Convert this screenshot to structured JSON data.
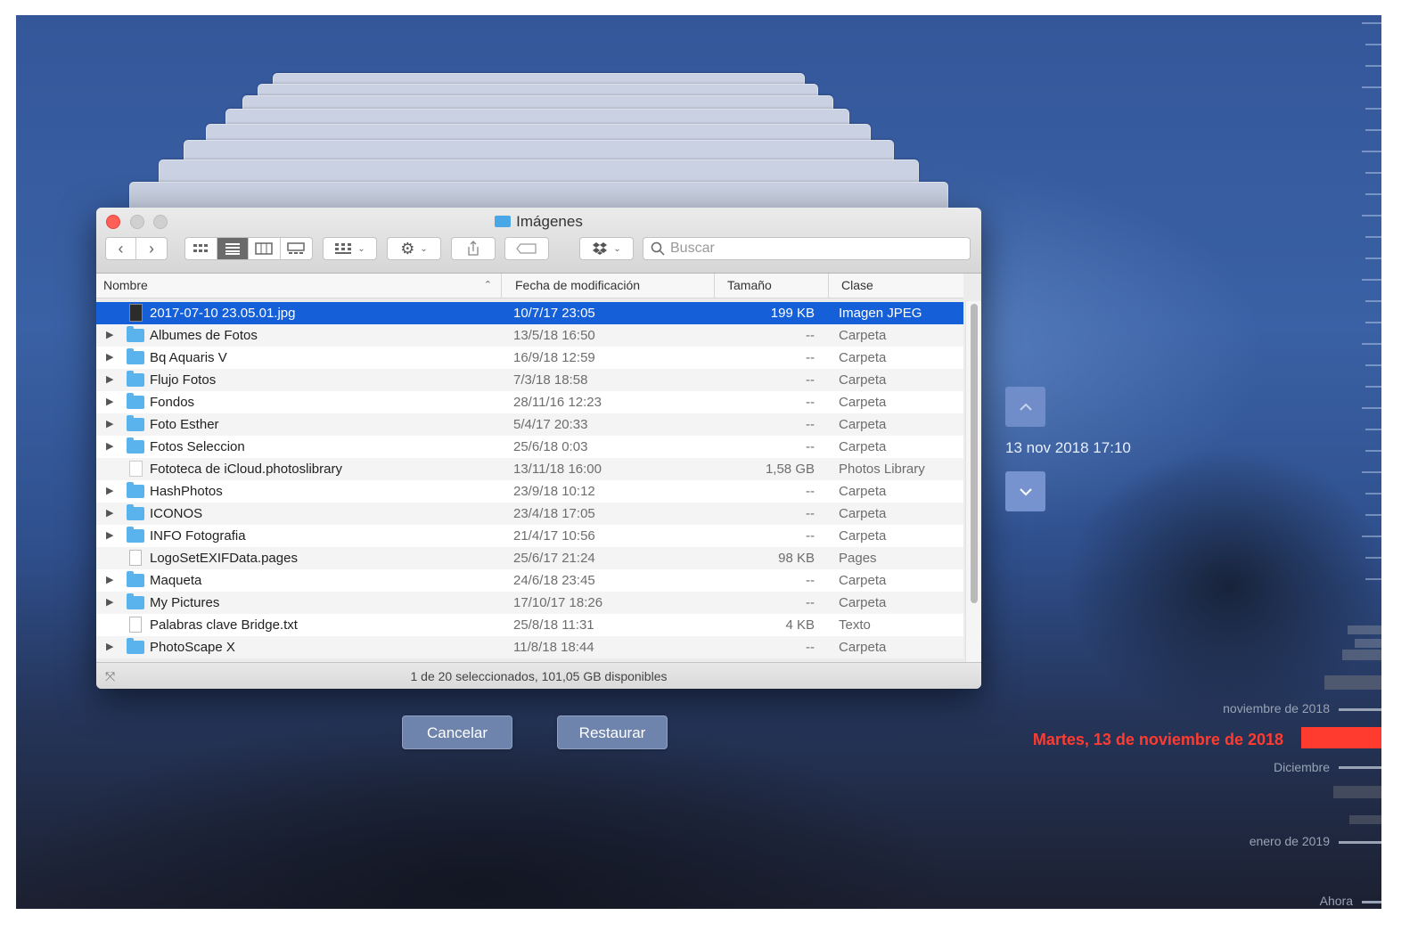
{
  "window": {
    "title": "Imágenes",
    "search_placeholder": "Buscar",
    "columns": {
      "name": "Nombre",
      "modified": "Fecha de modificación",
      "size": "Tamaño",
      "kind": "Clase"
    },
    "rows": [
      {
        "name": "2017-07-10 23.05.01.jpg",
        "modified": "10/7/17 23:05",
        "size": "199 KB",
        "kind": "Imagen JPEG",
        "icon": "jpeg-file-icon",
        "expandable": false,
        "selected": true
      },
      {
        "name": "Albumes de Fotos",
        "modified": "13/5/18 16:50",
        "size": "--",
        "kind": "Carpeta",
        "icon": "folder-icon",
        "expandable": true
      },
      {
        "name": "Bq Aquaris V",
        "modified": "16/9/18 12:59",
        "size": "--",
        "kind": "Carpeta",
        "icon": "folder-icon",
        "expandable": true
      },
      {
        "name": "Flujo Fotos",
        "modified": "7/3/18 18:58",
        "size": "--",
        "kind": "Carpeta",
        "icon": "folder-icon",
        "expandable": true
      },
      {
        "name": "Fondos",
        "modified": "28/11/16 12:23",
        "size": "--",
        "kind": "Carpeta",
        "icon": "folder-icon",
        "expandable": true
      },
      {
        "name": "Foto Esther",
        "modified": "5/4/17 20:33",
        "size": "--",
        "kind": "Carpeta",
        "icon": "folder-icon",
        "expandable": true
      },
      {
        "name": "Fotos Seleccion",
        "modified": "25/6/18 0:03",
        "size": "--",
        "kind": "Carpeta",
        "icon": "folder-icon",
        "expandable": true
      },
      {
        "name": "Fototeca de iCloud.photoslibrary",
        "modified": "13/11/18 16:00",
        "size": "1,58 GB",
        "kind": "Photos Library",
        "icon": "photos-library-icon",
        "expandable": false
      },
      {
        "name": "HashPhotos",
        "modified": "23/9/18 10:12",
        "size": "--",
        "kind": "Carpeta",
        "icon": "folder-icon",
        "expandable": true
      },
      {
        "name": "ICONOS",
        "modified": "23/4/18 17:05",
        "size": "--",
        "kind": "Carpeta",
        "icon": "folder-icon",
        "expandable": true
      },
      {
        "name": "INFO Fotografia",
        "modified": "21/4/17 10:56",
        "size": "--",
        "kind": "Carpeta",
        "icon": "folder-icon",
        "expandable": true
      },
      {
        "name": "LogoSetEXIFData.pages",
        "modified": "25/6/17 21:24",
        "size": "98 KB",
        "kind": "Pages",
        "icon": "pages-document-icon",
        "expandable": false
      },
      {
        "name": "Maqueta",
        "modified": "24/6/18 23:45",
        "size": "--",
        "kind": "Carpeta",
        "icon": "folder-icon",
        "expandable": true
      },
      {
        "name": "My Pictures",
        "modified": "17/10/17 18:26",
        "size": "--",
        "kind": "Carpeta",
        "icon": "folder-icon",
        "expandable": true
      },
      {
        "name": "Palabras clave Bridge.txt",
        "modified": "25/8/18 11:31",
        "size": "4 KB",
        "kind": "Texto",
        "icon": "text-file-icon",
        "expandable": false
      },
      {
        "name": "PhotoScape X",
        "modified": "11/8/18 18:44",
        "size": "--",
        "kind": "Carpeta",
        "icon": "folder-icon",
        "expandable": true
      }
    ],
    "status": "1 de 20 seleccionados, 101,05 GB disponibles"
  },
  "buttons": {
    "cancel": "Cancelar",
    "restore": "Restaurar"
  },
  "timemachine": {
    "current_snapshot": "13 nov 2018 17:10",
    "timeline": {
      "label_nov": "noviembre de 2018",
      "selected_date": "Martes, 13 de noviembre de 2018",
      "label_dec": "Diciembre",
      "label_jan": "enero de 2019",
      "label_now": "Ahora"
    },
    "accent_color": "#ff3b30"
  }
}
